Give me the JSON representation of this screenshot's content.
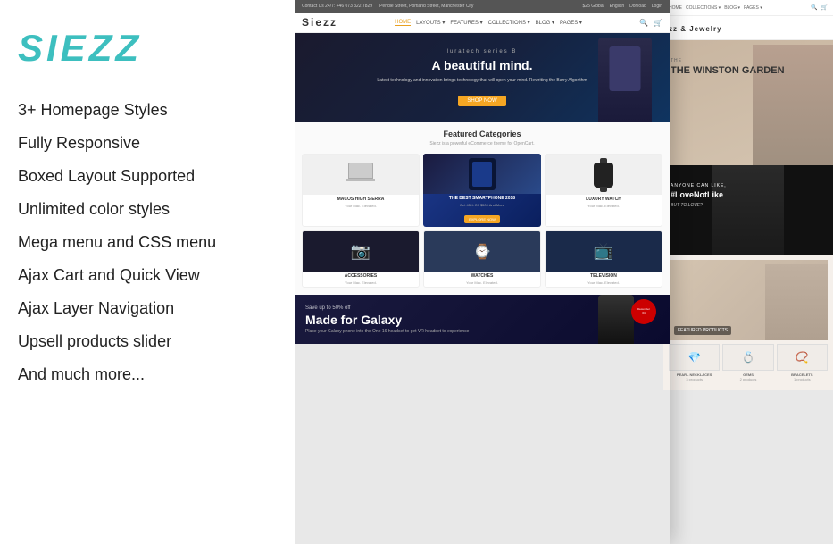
{
  "left_panel": {
    "logo": "SIEZZ",
    "features": [
      "3+ Homepage Styles",
      "Fully Responsive",
      "Boxed Layout Supported",
      "Unlimited color styles",
      "Mega menu and CSS menu",
      "Ajax Cart and Quick View",
      "Ajax Layer Navigation",
      "Upsell products slider",
      "And much more..."
    ]
  },
  "main_screenshot": {
    "top_bar": {
      "contact": "Contact Us 24/7: +46 073 322 7829",
      "address": "Pendle Street, Portland Street, Manchester City",
      "cart": "$25 Global",
      "language": "English",
      "download": "Donload",
      "login": "Login"
    },
    "nav": {
      "logo": "Siezz",
      "links": [
        "HOME",
        "LAYOUTS",
        "FEATURES",
        "COLLECTIONS",
        "BLOG",
        "PAGES"
      ]
    },
    "hero": {
      "series": "luratech series B",
      "title": "A beautiful mind.",
      "description": "Latest technology and innovation brings technology that will open your mind. Rewriting the Barry Algorithm",
      "button": "SHOP NOW"
    },
    "featured": {
      "title": "Featured Categories",
      "subtitle": "Siezz is a powerful eCommerce theme for OpenCart.",
      "categories": [
        {
          "name": "MACOS HIGH SIERRA",
          "sub": "Your Mac. Elevated.",
          "type": "laptop"
        },
        {
          "name": "THE BEST SMARTPHONE 2018",
          "sub": "Get 45% Off Your Order Of $500 And More",
          "type": "smartphone",
          "btn": "EXPLORE NOW"
        },
        {
          "name": "LUXURY WATCH",
          "sub": "Your Mac. Elevated.",
          "type": "watch"
        },
        {
          "name": "ACCESSORIES",
          "sub": "Your Mac. Elevated.",
          "type": "accessories"
        },
        {
          "name": "WATCHES",
          "sub": "Your Mac. Elevated.",
          "type": "watches"
        },
        {
          "name": "TELEVISION",
          "sub": "Your Mac. Elevated.",
          "type": "tv"
        }
      ]
    },
    "bottom_banner": {
      "promo": "Save up to 50% off",
      "title": "Made for Galaxy",
      "subtitle": "Place your Galaxy phone into the One 16 headset to get VR headset to experience",
      "badge": "December 04"
    }
  },
  "right_screenshot": {
    "brand": "zz & Jewelry",
    "fashion_hero": {
      "title": "THE WINSTON GARDEN"
    },
    "quote_section": {
      "label": "ANYONE CAN LIKE,",
      "brand": "#LoveNotLike",
      "sub": "BUT TO LOVE?"
    },
    "jewelry_section": {
      "title": "TURED PRODUCTS",
      "items": [
        {
          "name": "PEARL NECKLACES",
          "price": "3 products"
        },
        {
          "name": "GEMS",
          "price": "2 products"
        },
        {
          "name": "BRACELETS",
          "price": "1 products"
        }
      ]
    }
  },
  "colors": {
    "logo_teal": "#3dbfbf",
    "hero_accent": "#f5a623",
    "dark_bg": "#1a1a2e",
    "text_dark": "#222222"
  }
}
